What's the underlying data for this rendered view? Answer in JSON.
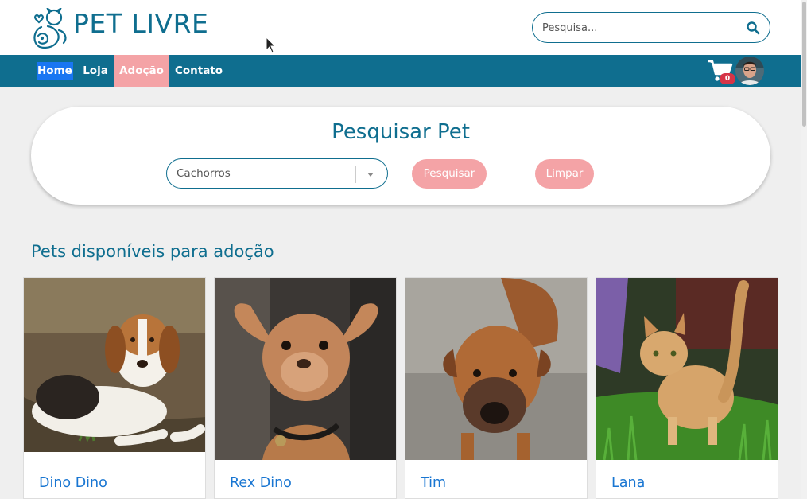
{
  "brand": {
    "name": "PET LIVRE"
  },
  "search": {
    "placeholder": "Pesquisa..."
  },
  "nav": {
    "items": [
      {
        "label": "Home"
      },
      {
        "label": "Loja"
      },
      {
        "label": "Adoção"
      },
      {
        "label": "Contato"
      }
    ]
  },
  "cart": {
    "count": "0"
  },
  "filter": {
    "title": "Pesquisar Pet",
    "selected": "Cachorros",
    "search_label": "Pesquisar",
    "clear_label": "Limpar"
  },
  "section": {
    "title": "Pets disponíveis para adoção"
  },
  "pets": [
    {
      "name": "Dino Dino"
    },
    {
      "name": "Rex Dino"
    },
    {
      "name": "Tim"
    },
    {
      "name": "Lana"
    }
  ],
  "colors": {
    "primary": "#0f6e8f",
    "accent": "#f4a3a6",
    "link": "#1976d2",
    "badge": "#d63447"
  }
}
